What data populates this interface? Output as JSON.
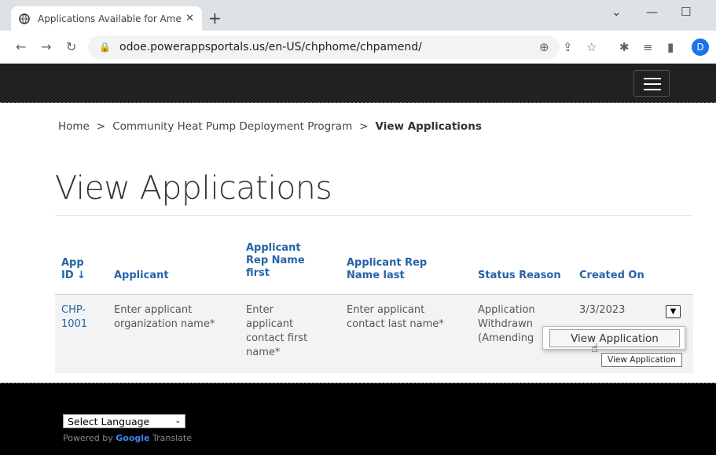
{
  "browser": {
    "tab_title": "Applications Available for Amend",
    "tab_close": "✕",
    "new_tab": "+",
    "url": "odoe.powerappsportals.us/en-US/chphome/chpamend/",
    "profile_initial": "D"
  },
  "site": {
    "breadcrumb": [
      "Home",
      "Community Heat Pump Deployment Program",
      "View Applications"
    ],
    "breadcrumb_sep": ">",
    "page_title": "View Applications"
  },
  "table": {
    "headers": [
      "App ID ↓",
      "Applicant",
      "Applicant Rep Name first",
      "Applicant Rep Name last",
      "Status Reason",
      "Created On"
    ],
    "header_lines": [
      [
        "App",
        "ID ↓"
      ],
      [
        "Applicant"
      ],
      [
        "Applicant",
        "Rep Name",
        "first"
      ],
      [
        "Applicant Rep",
        "Name last"
      ],
      [
        "Status Reason"
      ],
      [
        "Created On"
      ]
    ],
    "row": {
      "app_id": [
        "CHP-",
        "1001"
      ],
      "applicant": [
        "Enter applicant",
        "organization name*"
      ],
      "rep_first": [
        "Enter",
        "applicant",
        "contact first",
        "name*"
      ],
      "rep_last": [
        "Enter applicant",
        "contact last name*"
      ],
      "status": [
        "Application",
        "Withdrawn",
        "(Amending"
      ],
      "created": [
        "3/3/2023"
      ]
    },
    "menu_item": "View Application",
    "tooltip": "View Application"
  },
  "footer": {
    "language_select": "Select Language",
    "powered_by": "Powered by",
    "google": "Google",
    "translate": "Translate"
  }
}
